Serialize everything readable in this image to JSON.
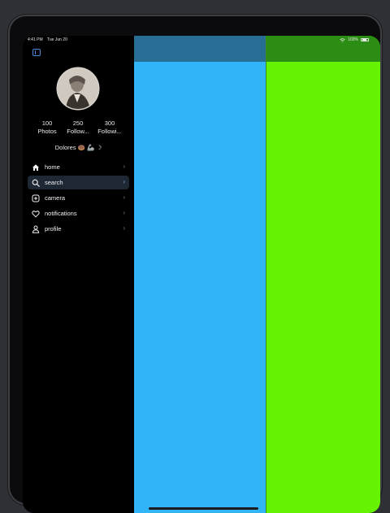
{
  "status_bar": {
    "time": "4:41 PM",
    "date": "Tue Jun 20",
    "battery": "100%"
  },
  "profile": {
    "stats": [
      {
        "value": "100",
        "label": "Photos"
      },
      {
        "value": "250",
        "label": "Follow..."
      },
      {
        "value": "300",
        "label": "Followi..."
      }
    ],
    "username": "Dolores 🍩 🦾 ☽"
  },
  "nav": {
    "items": [
      {
        "label": "home",
        "icon": "house-icon",
        "active": false
      },
      {
        "label": "search",
        "icon": "search-icon",
        "active": true
      },
      {
        "label": "camera",
        "icon": "camera-plus-icon",
        "active": false
      },
      {
        "label": "notifications",
        "icon": "heart-icon",
        "active": false
      },
      {
        "label": "profile",
        "icon": "person-icon",
        "active": false
      }
    ],
    "chevron": "›"
  },
  "colors": {
    "accent": "#4a88d8",
    "blue_column": "#32b4f8",
    "blue_header": "#286d93",
    "green_column": "#67f402",
    "green_header": "#2c8d14"
  }
}
